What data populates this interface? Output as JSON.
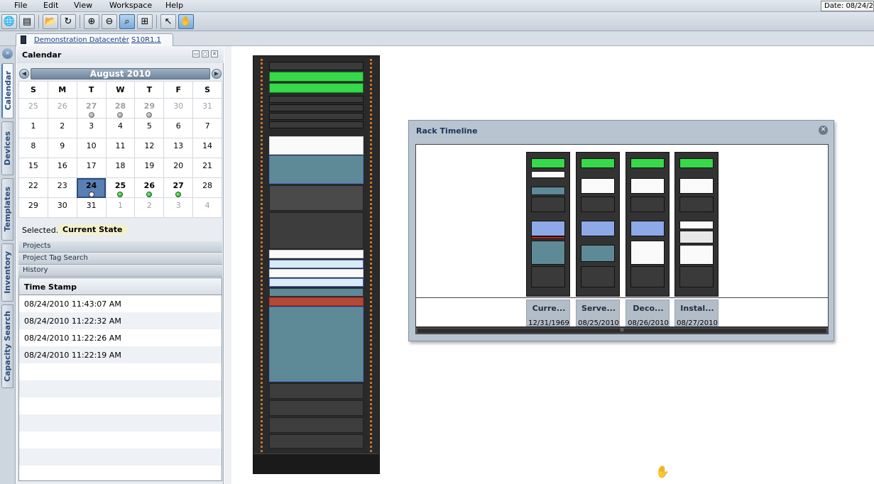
{
  "menubar": {
    "items": [
      "File",
      "Edit",
      "View",
      "Workspace",
      "Help"
    ],
    "date_label": "Date: 08/24/20"
  },
  "toolbar": {
    "icons": [
      "globe-icon",
      "server-icon",
      "folder-icon",
      "refresh-icon",
      "zoom-in-icon",
      "zoom-out-icon",
      "zoom-fit-icon",
      "zoom-region-icon",
      "pointer-icon",
      "hand-icon"
    ]
  },
  "breadcrumb": {
    "datacenter": "Demonstration Datacenter",
    "rack": "S10R1.1"
  },
  "side_tabs": [
    "Calendar",
    "Devices",
    "Templates",
    "Inventory",
    "Capacity Search"
  ],
  "calendar": {
    "title": "Calendar",
    "month_label": "August 2010",
    "weekdays": [
      "S",
      "M",
      "T",
      "W",
      "T",
      "F",
      "S"
    ],
    "weeks": [
      [
        {
          "d": "25",
          "o": true
        },
        {
          "d": "26",
          "o": true
        },
        {
          "d": "27",
          "o": true,
          "b": true,
          "dot": "gray"
        },
        {
          "d": "28",
          "o": true,
          "b": true,
          "dot": "gray"
        },
        {
          "d": "29",
          "o": true,
          "b": true,
          "dot": "gray"
        },
        {
          "d": "30",
          "o": true
        },
        {
          "d": "31",
          "o": true
        }
      ],
      [
        {
          "d": "1"
        },
        {
          "d": "2"
        },
        {
          "d": "3"
        },
        {
          "d": "4"
        },
        {
          "d": "5"
        },
        {
          "d": "6"
        },
        {
          "d": "7"
        }
      ],
      [
        {
          "d": "8"
        },
        {
          "d": "9"
        },
        {
          "d": "10"
        },
        {
          "d": "11"
        },
        {
          "d": "12"
        },
        {
          "d": "13"
        },
        {
          "d": "14"
        }
      ],
      [
        {
          "d": "15"
        },
        {
          "d": "16"
        },
        {
          "d": "17"
        },
        {
          "d": "18"
        },
        {
          "d": "19"
        },
        {
          "d": "20"
        },
        {
          "d": "21"
        }
      ],
      [
        {
          "d": "22"
        },
        {
          "d": "23"
        },
        {
          "d": "24",
          "today": true,
          "dot": "clock"
        },
        {
          "d": "25",
          "b": true,
          "dot": "green"
        },
        {
          "d": "26",
          "b": true,
          "dot": "green"
        },
        {
          "d": "27",
          "b": true,
          "dot": "green"
        },
        {
          "d": "28"
        }
      ],
      [
        {
          "d": "29"
        },
        {
          "d": "30"
        },
        {
          "d": "31"
        },
        {
          "d": "1",
          "o": true
        },
        {
          "d": "2",
          "o": true
        },
        {
          "d": "3",
          "o": true
        },
        {
          "d": "4",
          "o": true
        }
      ]
    ],
    "selected_label": "Selected:",
    "selected_value": "Current State"
  },
  "accordion": [
    "Projects",
    "Project Tag Search",
    "History"
  ],
  "history": {
    "column": "Time Stamp",
    "rows": [
      "08/24/2010 11:43:07 AM",
      "08/24/2010 11:22:32 AM",
      "08/24/2010 11:22:26 AM",
      "08/24/2010 11:22:19 AM"
    ]
  },
  "rack_timeline": {
    "title": "Rack Timeline",
    "entries": [
      {
        "name": "Curre...",
        "date": "12/31/1969"
      },
      {
        "name": "Serve...",
        "date": "08/25/2010"
      },
      {
        "name": "Deco...",
        "date": "08/26/2010"
      },
      {
        "name": "Instal...",
        "date": "08/27/2010"
      }
    ]
  }
}
